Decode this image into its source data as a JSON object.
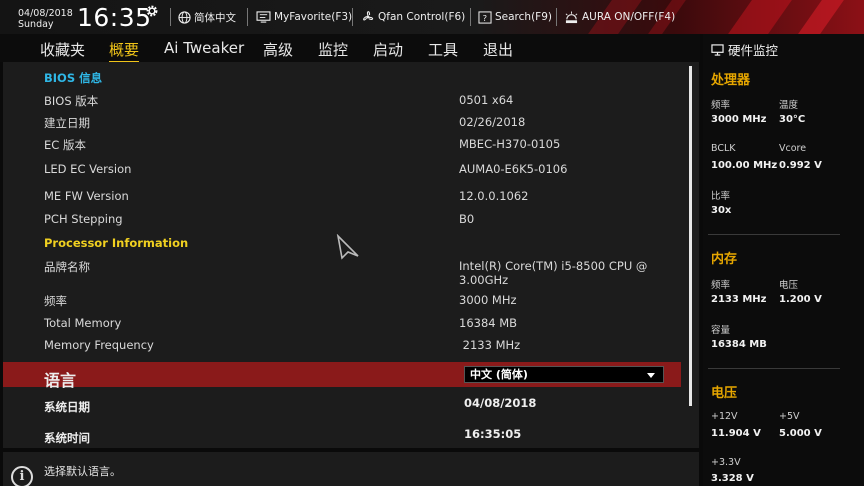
{
  "topbar": {
    "date": "04/08/2018",
    "weekday": "Sunday",
    "time": "16:35",
    "language_label": "简体中文",
    "myfavorite_label": "MyFavorite(F3)",
    "qfan_label": "Qfan Control(F6)",
    "search_label": "Search(F9)",
    "aura_label": "AURA ON/OFF(F4)"
  },
  "nav": {
    "tabs": [
      "收藏夹",
      "概要",
      "Ai Tweaker",
      "高级",
      "监控",
      "启动",
      "工具",
      "退出"
    ],
    "active": "概要"
  },
  "main": {
    "bios_section": "BIOS 信息",
    "bios_rows": [
      {
        "label": "BIOS 版本",
        "value": "0501  x64"
      },
      {
        "label": "建立日期",
        "value": "02/26/2018"
      },
      {
        "label": "EC 版本",
        "value": "MBEC-H370-0105"
      },
      {
        "label": "LED EC Version",
        "value": "AUMA0-E6K5-0106"
      },
      {
        "label": "ME FW Version",
        "value": "12.0.0.1062"
      },
      {
        "label": "PCH Stepping",
        "value": "B0"
      }
    ],
    "proc_section": "Processor Information",
    "proc_rows": [
      {
        "label": "品牌名称",
        "value": "Intel(R) Core(TM) i5-8500 CPU @",
        "value2": "3.00GHz"
      },
      {
        "label": "频率",
        "value": "3000 MHz"
      },
      {
        "label": "Total Memory",
        "value": "16384 MB"
      },
      {
        "label": "Memory Frequency",
        "value": " 2133 MHz"
      }
    ],
    "language": {
      "label": "语言",
      "value": "中文 (简体)"
    },
    "system_date": {
      "label": "系统日期",
      "value": "04/08/2018"
    },
    "system_time": {
      "label": "系统时间",
      "value": "16:35:05"
    }
  },
  "help": {
    "text": "选择默认语言。"
  },
  "hw_monitor": {
    "title": "硬件监控",
    "cpu": {
      "title": "处理器",
      "freq_label": "频率",
      "freq": "3000 MHz",
      "temp_label": "温度",
      "temp": "30°C",
      "bclk_label": "BCLK",
      "bclk": "100.00 MHz",
      "vcore_label": "Vcore",
      "vcore": "0.992 V",
      "ratio_label": "比率",
      "ratio": "30x"
    },
    "memory": {
      "title": "内存",
      "freq_label": "频率",
      "freq": "2133 MHz",
      "volt_label": "电压",
      "volt": "1.200 V",
      "cap_label": "容量",
      "cap": "16384 MB"
    },
    "voltage": {
      "title": "电压",
      "v12_label": "+12V",
      "v12": "11.904 V",
      "v5_label": "+5V",
      "v5": "5.000 V",
      "v33_label": "+3.3V",
      "v33": "3.328 V"
    }
  },
  "colors": {
    "accent_yellow": "#f0c419",
    "section_cyan": "#2fb7e6",
    "section_yellow": "#f0d020",
    "highlight_red": "#8a1a1a",
    "monitor_orange": "#e6a600"
  }
}
